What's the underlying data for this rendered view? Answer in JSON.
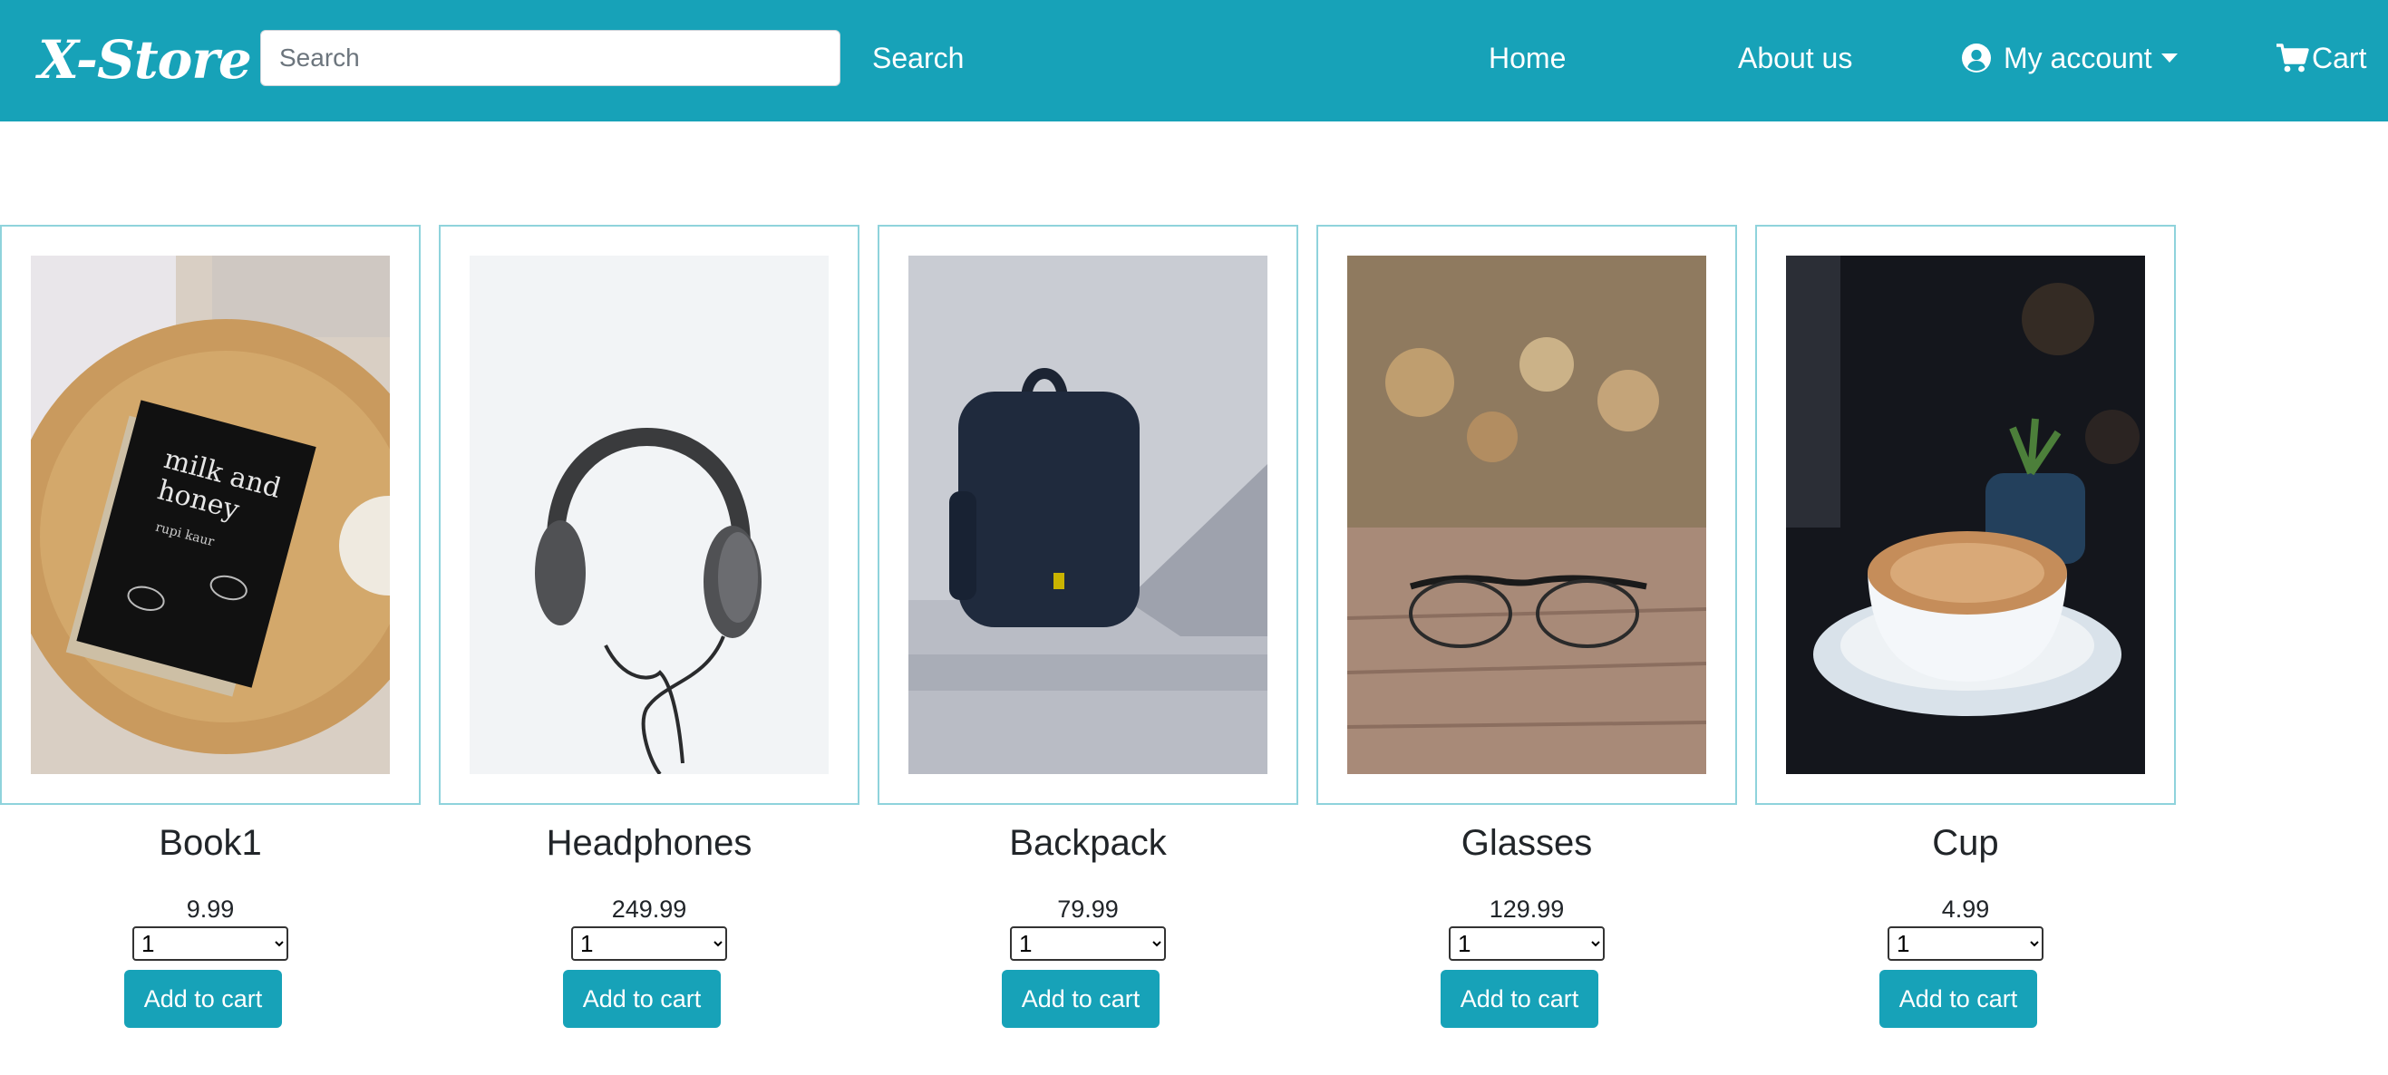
{
  "navbar": {
    "brand": "X-Store",
    "search_placeholder": "Search",
    "search_button": "Search",
    "links": {
      "home": "Home",
      "about": "About us",
      "account": "My account",
      "cart": "Cart"
    },
    "color": "#17a2b8"
  },
  "products": [
    {
      "name": "Book1",
      "price": "9.99",
      "qty": "1",
      "button": "Add to cart",
      "image": "book-photo"
    },
    {
      "name": "Headphones",
      "price": "249.99",
      "qty": "1",
      "button": "Add to cart",
      "image": "headphones-photo"
    },
    {
      "name": "Backpack",
      "price": "79.99",
      "qty": "1",
      "button": "Add to cart",
      "image": "backpack-photo"
    },
    {
      "name": "Glasses",
      "price": "129.99",
      "qty": "1",
      "button": "Add to cart",
      "image": "glasses-photo"
    },
    {
      "name": "Cup",
      "price": "4.99",
      "qty": "1",
      "button": "Add to cart",
      "image": "cup-photo"
    }
  ],
  "book_cover": {
    "title_line1": "milk and",
    "title_line2": "honey",
    "author": "rupi kaur"
  }
}
